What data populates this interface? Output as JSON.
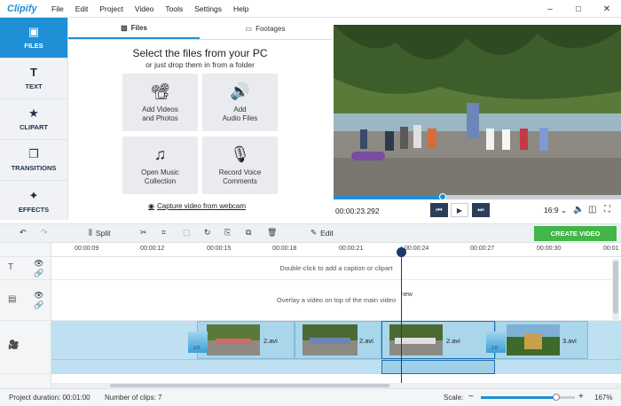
{
  "app": {
    "logo": "Clipify"
  },
  "menu": [
    "File",
    "Edit",
    "Project",
    "Video",
    "Tools",
    "Settings",
    "Help"
  ],
  "window_controls": {
    "minimize": "–",
    "maximize": "□",
    "close": "✕"
  },
  "sidebar": {
    "items": [
      {
        "label": "FILES",
        "icon": "film-icon",
        "glyph": "▣",
        "active": true
      },
      {
        "label": "TEXT",
        "icon": "text-icon",
        "glyph": "T",
        "active": false
      },
      {
        "label": "CLIPART",
        "icon": "star-icon",
        "glyph": "★",
        "active": false
      },
      {
        "label": "TRANSITIONS",
        "icon": "transitions-icon",
        "glyph": "❐",
        "active": false
      },
      {
        "label": "EFFECTS",
        "icon": "magic-wand-icon",
        "glyph": "✦",
        "active": false
      }
    ]
  },
  "panel": {
    "tabs": [
      {
        "label": "Files",
        "glyph": "▨",
        "active": true
      },
      {
        "label": "Footages",
        "glyph": "▭",
        "active": false
      }
    ],
    "heading": "Select the files from your PC",
    "subheading": "or just drop them in from a folder",
    "tiles": [
      {
        "label1": "Add Videos",
        "label2": "and Photos",
        "glyph": "📽"
      },
      {
        "label1": "Add",
        "label2": "Audio Files",
        "glyph": "🔊"
      },
      {
        "label1": "Open Music",
        "label2": "Collection",
        "glyph": "♫"
      },
      {
        "label1": "Record Voice",
        "label2": "Comments",
        "glyph": "🎙"
      }
    ],
    "webcam_link": "Capture video from webcam"
  },
  "player": {
    "time": "00:00:23.292",
    "aspect": "16:9 ⌄",
    "progress": 0.38,
    "prev_glyph": "⏮",
    "play_glyph": "▶",
    "next_glyph": "⏭"
  },
  "toolbar": {
    "undo": "↶",
    "redo": "↷",
    "split": "Split",
    "edit": "Edit",
    "create": "CREATE VIDEO"
  },
  "ruler": {
    "ticks": [
      "00:00:09",
      "00:00:12",
      "00:00:15",
      "00:00:18",
      "00:00:21",
      "00:00:24",
      "00:00:27",
      "00:00:30",
      "00:01"
    ]
  },
  "tracks": {
    "caption_hint": "Double-click to add a caption or clipart",
    "overlay_hint": "Overlay a video on top of the main video",
    "new_label": "new"
  },
  "clips": [
    {
      "name": "2.avi"
    },
    {
      "name": "2.avi"
    },
    {
      "name": "2.avi"
    },
    {
      "name": "3.avi"
    }
  ],
  "transitions": [
    {
      "value": "2.0"
    },
    {
      "value": "2.0"
    }
  ],
  "status": {
    "duration": "Project duration:  00:01:00",
    "clips": "Number of clips: 7",
    "scale_label": "Scale:",
    "zoom_minus": "−",
    "zoom_plus": "+",
    "zoom_value": "167%",
    "zoom_fraction": 0.8
  }
}
